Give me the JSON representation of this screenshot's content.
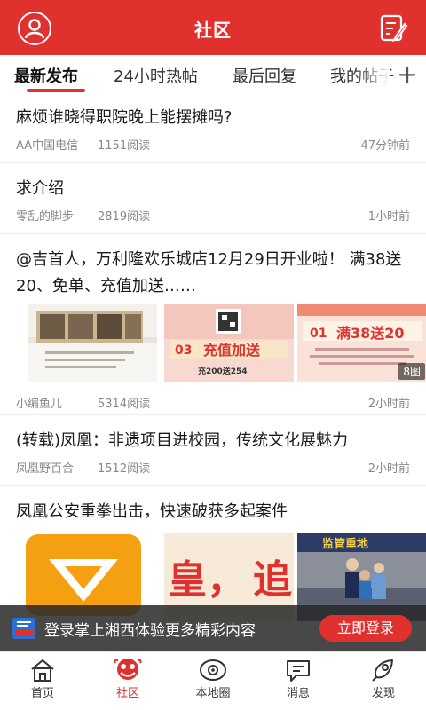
{
  "header": {
    "title": "社区"
  },
  "tabs": [
    {
      "label": "最新发布",
      "active": true
    },
    {
      "label": "24小时热帖",
      "active": false
    },
    {
      "label": "最后回复",
      "active": false
    },
    {
      "label": "我的帖子",
      "active": false
    }
  ],
  "posts": [
    {
      "title": "麻烦谁晓得职院晚上能摆摊吗?",
      "author": "AA中国电信",
      "reads": "1151阅读",
      "time": "47分钟前"
    },
    {
      "title": "求介绍",
      "author": "零乱的脚步",
      "reads": "2819阅读",
      "time": "1小时前"
    },
    {
      "title": "@吉首人，万利隆欢乐城店12月29日开业啦！ 满38送20、免单、充值加送……",
      "author": "小编鱼儿",
      "reads": "5314阅读",
      "time": "2小时前",
      "images": {
        "img2_num": "03",
        "img2_text": "充值加送",
        "img2_sub": "充200送254",
        "img3_num": "01",
        "img3_text": "满38送20",
        "count_badge": "8图"
      }
    },
    {
      "title": "(转载)凤凰：非遗项目进校园，传统文化展魅力",
      "author": "凤凰野百合",
      "reads": "1512阅读",
      "time": "2小时前"
    },
    {
      "title": "凤凰公安重拳出击，快速破获多起案件",
      "images": {
        "img2_text": "追",
        "img3_sign": "监管重地"
      }
    }
  ],
  "banner": {
    "text": "登录掌上湘西体验更多精彩内容",
    "button": "立即登录",
    "logo_text": "掌上湘西"
  },
  "nav": [
    {
      "label": "首页",
      "icon": "home-icon",
      "active": false
    },
    {
      "label": "社区",
      "icon": "community-icon",
      "active": true
    },
    {
      "label": "本地圈",
      "icon": "local-circle-icon",
      "active": false
    },
    {
      "label": "消息",
      "icon": "message-icon",
      "active": false
    },
    {
      "label": "发现",
      "icon": "discover-icon",
      "active": false
    }
  ],
  "colors": {
    "brand": "#e0312f",
    "text": "#1a1a1a",
    "meta": "#888888"
  }
}
